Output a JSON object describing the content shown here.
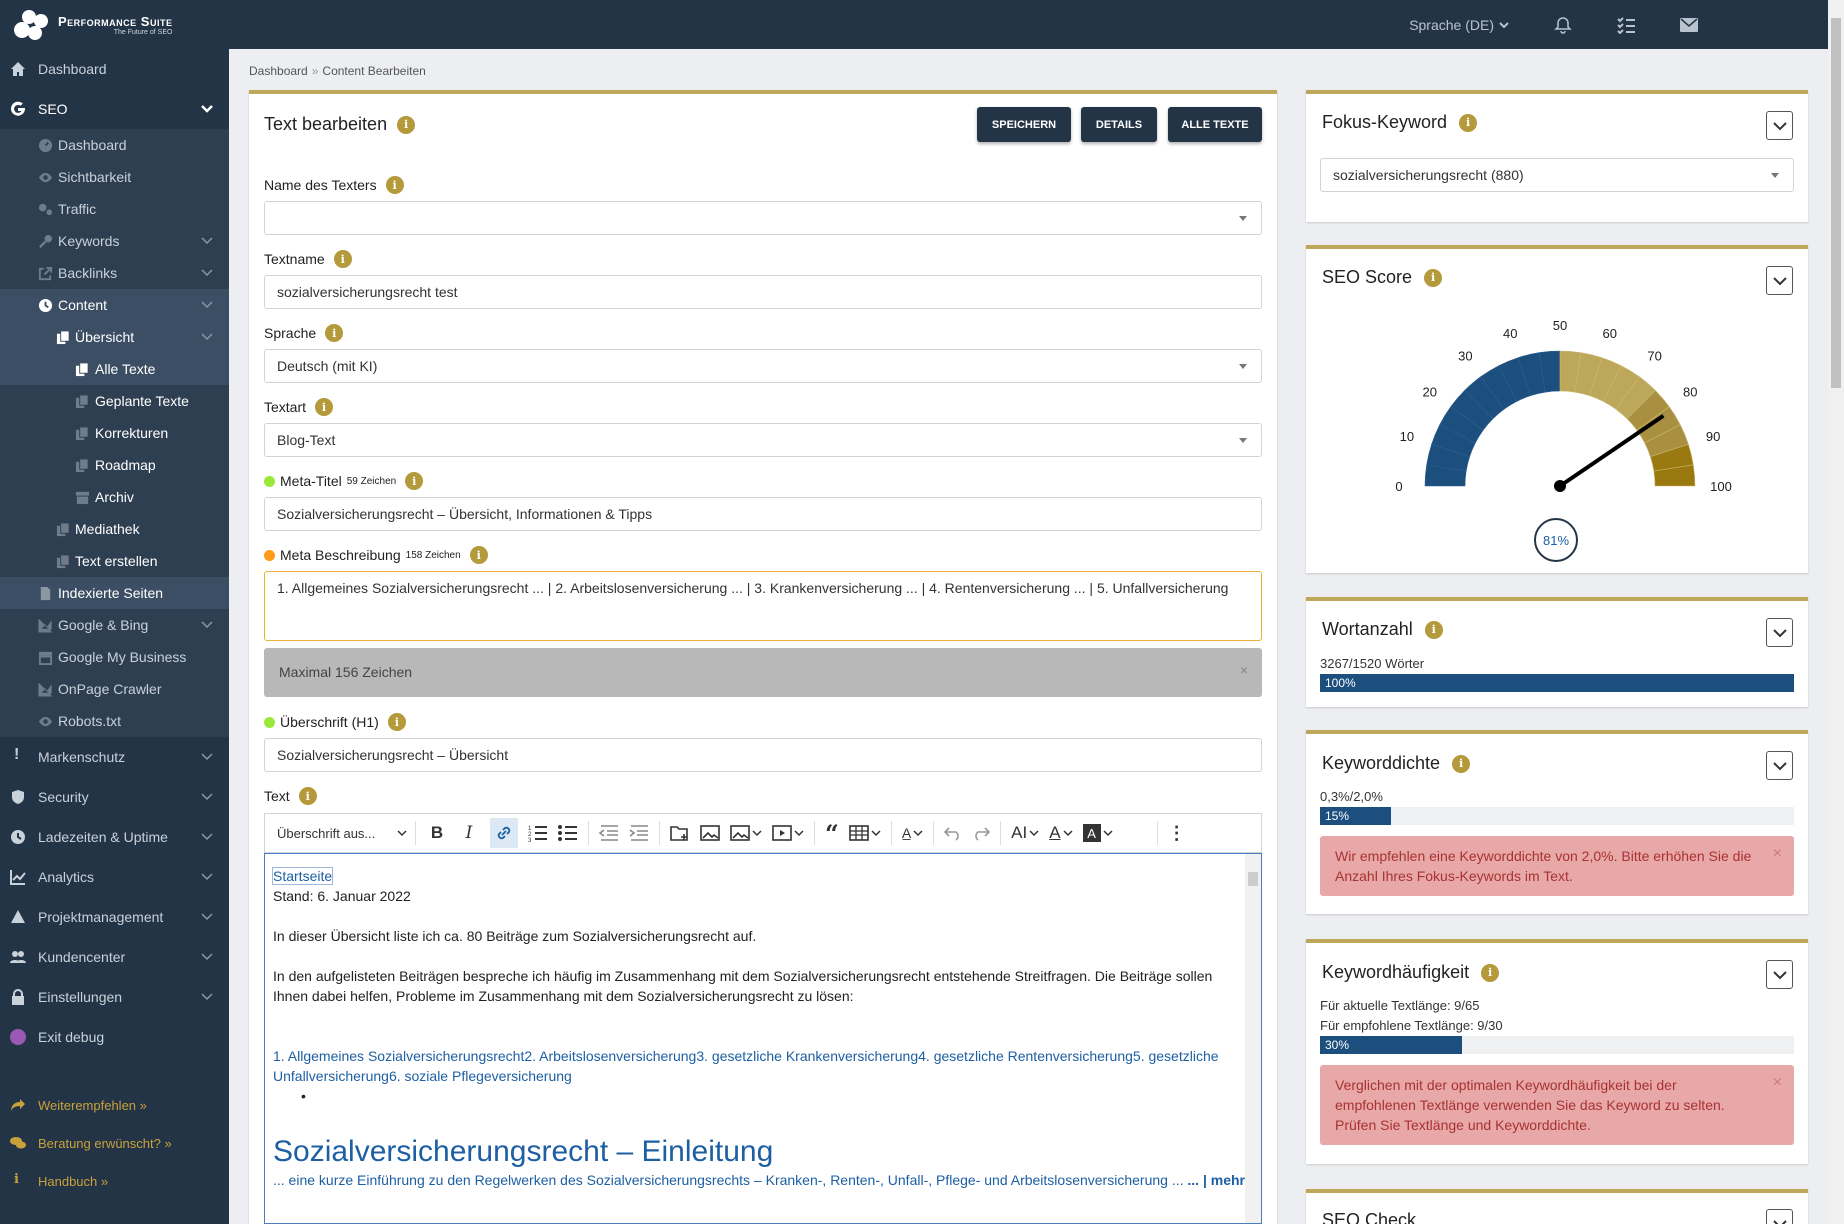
{
  "brand": {
    "name": "Performance Suite",
    "tagline": "The Future of SEO"
  },
  "topbar": {
    "language": "Sprache (DE)"
  },
  "sidebar": {
    "dashboard": "Dashboard",
    "seo": "SEO",
    "seo_items": [
      "Dashboard",
      "Sichtbarkeit",
      "Traffic",
      "Keywords",
      "Backlinks",
      "Content"
    ],
    "content_items": {
      "uebersicht": "Übersicht",
      "alle_texte": "Alle Texte",
      "geplante": "Geplante Texte",
      "korrekturen": "Korrekturen",
      "roadmap": "Roadmap",
      "archiv": "Archiv",
      "mediathek": "Mediathek",
      "text_erstellen": "Text erstellen"
    },
    "seo_more": [
      "Indexierte Seiten",
      "Google & Bing",
      "Google My Business",
      "OnPage Crawler",
      "Robots.txt"
    ],
    "main": [
      "Markenschutz",
      "Security",
      "Ladezeiten & Uptime",
      "Analytics",
      "Projektmanagement",
      "Kundencenter",
      "Einstellungen",
      "Exit debug"
    ],
    "footer": [
      "Weiterempfehlen »",
      "Beratung erwünscht? »",
      "Handbuch »"
    ]
  },
  "breadcrumb": {
    "home": "Dashboard",
    "current": "Content Bearbeiten"
  },
  "editor_panel": {
    "title": "Text bearbeiten",
    "buttons": {
      "save": "SPEICHERN",
      "details": "DETAILS",
      "all": "ALLE TEXTE"
    },
    "labels": {
      "writer": "Name des Texters",
      "textname": "Textname",
      "language": "Sprache",
      "texttype": "Textart",
      "meta_title": "Meta-Titel",
      "meta_title_count": "59 Zeichen",
      "meta_desc": "Meta Beschreibung",
      "meta_desc_count": "158 Zeichen",
      "h1": "Überschrift (H1)",
      "text": "Text"
    },
    "values": {
      "writer": "",
      "textname": "sozialversicherungsrecht test",
      "language": "Deutsch (mit KI)",
      "texttype": "Blog-Text",
      "meta_title": "Sozialversicherungsrecht – Übersicht, Informationen & Tipps",
      "meta_desc": "1. Allgemeines Sozialversicherungsrecht ... | 2. Arbeitslosenversicherung ... | 3. Krankenversicherung ... | 4. Rentenversicherung ... | 5. Unfallversicherung",
      "h1": "Sozialversicherungsrecht – Übersicht"
    },
    "meta_desc_warning": "Maximal 156 Zeichen",
    "toolbar": {
      "heading_select": "Überschrift aus..."
    },
    "content": {
      "p1": "Startseite",
      "p2": "Stand: 6. Januar 2022",
      "p3": "In dieser Übersicht liste ich ca. 80 Beiträge zum Sozialversicherungsrecht auf.",
      "p4": "In den aufgelisteten Beiträgen bespreche ich häufig im Zusammenhang mit dem Sozialversicherungsrecht entstehende Streitfragen. Die Beiträge sollen Ihnen dabei helfen, Probleme im Zusammenhang mit dem Sozialversicherungsrecht zu lösen:",
      "links": "1. Allgemeines Sozialversicherungsrecht2. Arbeitslosenversicherung3. gesetzliche Krankenversicherung4. gesetzliche Rentenversicherung5. gesetzliche Unfallversicherung6. soziale Pflegeversicherung",
      "h2": "Sozialversicherungsrecht – Einleitung",
      "intro": "... eine kurze Einführung zu den Regelwerken des Sozialversicherungsrechts – Kranken-, Renten-, Unfall-, Pflege- und Arbeitslosenversicherung ...",
      "more": "... | mehr"
    }
  },
  "right": {
    "focus": {
      "title": "Fokus-Keyword",
      "value": "sozialversicherungsrecht (880)"
    },
    "score": {
      "title": "SEO Score",
      "value": 81,
      "label": "81%",
      "ticks": [
        "0",
        "10",
        "20",
        "30",
        "40",
        "50",
        "60",
        "70",
        "80",
        "90",
        "100"
      ]
    },
    "words": {
      "title": "Wortanzahl",
      "text": "3267/1520 Wörter",
      "percent": 100,
      "label": "100%"
    },
    "density": {
      "title": "Keyworddichte",
      "text": "0,3%/2,0%",
      "percent": 15,
      "label": "15%",
      "alert": "Wir empfehlen eine Keyworddichte von 2,0%. Bitte erhöhen Sie die Anzahl Ihres Fokus-Keywords im Text."
    },
    "frequency": {
      "title": "Keywordhäufigkeit",
      "line1": "Für aktuelle Textlänge: 9/65",
      "line2": "Für empfohlene Textlänge: 9/30",
      "percent": 30,
      "label": "30%",
      "alert": "Verglichen mit der optimalen Keywordhäufigkeit bei der empfohlenen Textlänge verwenden Sie das Keyword zu selten. Prüfen Sie Textlänge und Keyworddichte."
    },
    "check": {
      "title": "SEO Check"
    }
  },
  "colors": {
    "accent": "#bda75b",
    "navy": "#243447",
    "blue": "#1c4f7d"
  }
}
